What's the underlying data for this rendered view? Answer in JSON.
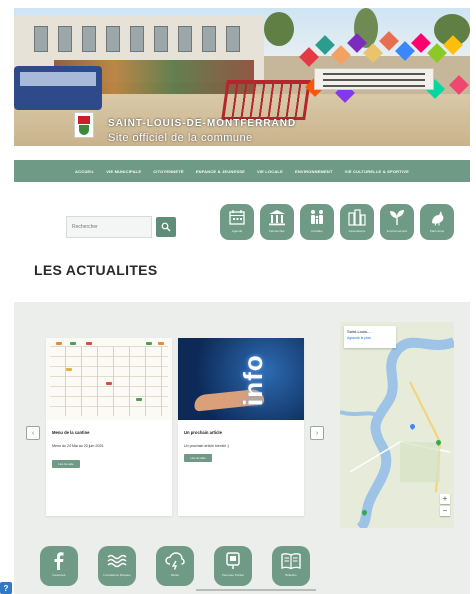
{
  "hero": {
    "title": "SAINT-LOUIS-DE-MONTFERRAND",
    "subtitle": "Site officiel de la commune",
    "banner_lines": 3
  },
  "nav": {
    "items": [
      "ACCUEIL",
      "VIE MUNICIPALE",
      "CITOYENNETÉ",
      "ENFANCE & JEUNESSE",
      "VIE LOCALE",
      "ENVIRONNEMENT",
      "VIE CULTURELLE & SPORTIVE"
    ]
  },
  "search": {
    "placeholder": "Rechercher"
  },
  "quick_links": [
    {
      "label": "Agenda",
      "icon": "calendar-icon"
    },
    {
      "label": "Démarches",
      "icon": "town-hall-icon"
    },
    {
      "label": "Familles",
      "icon": "family-icon"
    },
    {
      "label": "Associations",
      "icon": "buildings-icon"
    },
    {
      "label": "Environnement",
      "icon": "plant-icon"
    },
    {
      "label": "Patrimoine",
      "icon": "bird-icon"
    }
  ],
  "section": {
    "title": "LES ACTUALITES"
  },
  "cards": [
    {
      "title": "Menu de la cantine",
      "text": "Menu du 24 Mai au 20 juin 2025",
      "button": "Lire la suite"
    },
    {
      "title": "Un prochain article",
      "text": "Un prochain article bientôt :)",
      "button": "Lire la suite"
    }
  ],
  "info_card_image_text": "info",
  "map": {
    "place": "Saint-Louis-...",
    "link": "Agrandir le plan",
    "zoom_in": "+",
    "zoom_out": "−"
  },
  "footer_links": [
    {
      "label": "Facebook",
      "icon": "facebook-icon"
    },
    {
      "label": "Inondations Risques",
      "icon": "waves-icon"
    },
    {
      "label": "Météo",
      "icon": "weather-icon"
    },
    {
      "label": "Panneau Pocket",
      "icon": "phone-icon"
    },
    {
      "label": "Bulletins",
      "icon": "book-icon"
    }
  ],
  "arrows": {
    "prev": "‹",
    "next": "›"
  },
  "help_icon": "?",
  "colors": {
    "accent": "#6f9a86",
    "accent_dark": "#5f8d7a",
    "news_bg": "#eceeec"
  }
}
